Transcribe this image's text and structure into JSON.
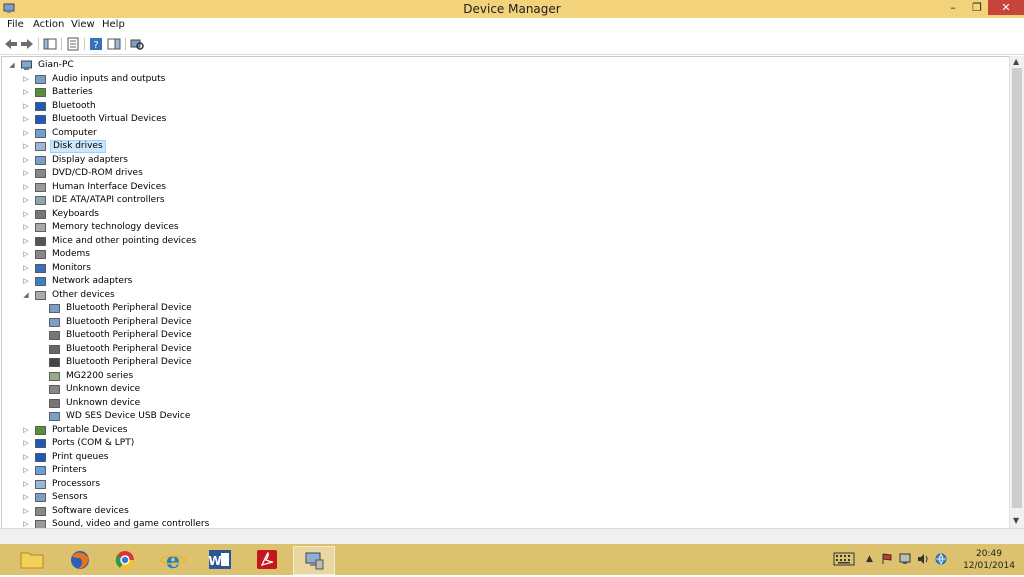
{
  "window": {
    "title": "Device Manager",
    "min_glyph": "–",
    "max_glyph": "❐",
    "close_glyph": "✕"
  },
  "menu": {
    "items": [
      "File",
      "Action",
      "View",
      "Help"
    ]
  },
  "tree": {
    "root": "Gian-PC",
    "categories": [
      "Audio inputs and outputs",
      "Batteries",
      "Bluetooth",
      "Bluetooth Virtual Devices",
      "Computer",
      "Disk drives",
      "Display adapters",
      "DVD/CD-ROM drives",
      "Human Interface Devices",
      "IDE ATA/ATAPI controllers",
      "Keyboards",
      "Memory technology devices",
      "Mice and other pointing devices",
      "Modems",
      "Monitors",
      "Network adapters",
      "Other devices"
    ],
    "other_devices": [
      "Bluetooth Peripheral Device",
      "Bluetooth Peripheral Device",
      "Bluetooth Peripheral Device",
      "Bluetooth Peripheral Device",
      "Bluetooth Peripheral Device",
      "MG2200 series",
      "Unknown device",
      "Unknown device",
      "WD SES Device USB Device"
    ],
    "categories_after": [
      "Portable Devices",
      "Ports (COM & LPT)",
      "Print queues",
      "Printers",
      "Processors",
      "Sensors",
      "Software devices",
      "Sound, video and game controllers"
    ],
    "selected": "Disk drives"
  },
  "clock": {
    "time": "20:49",
    "date": "12/01/2014"
  },
  "colors": {
    "title_bar": "#f2d27a",
    "taskbar": "#dcc26e",
    "selection": "#cce8ff",
    "close": "#c7443a"
  }
}
